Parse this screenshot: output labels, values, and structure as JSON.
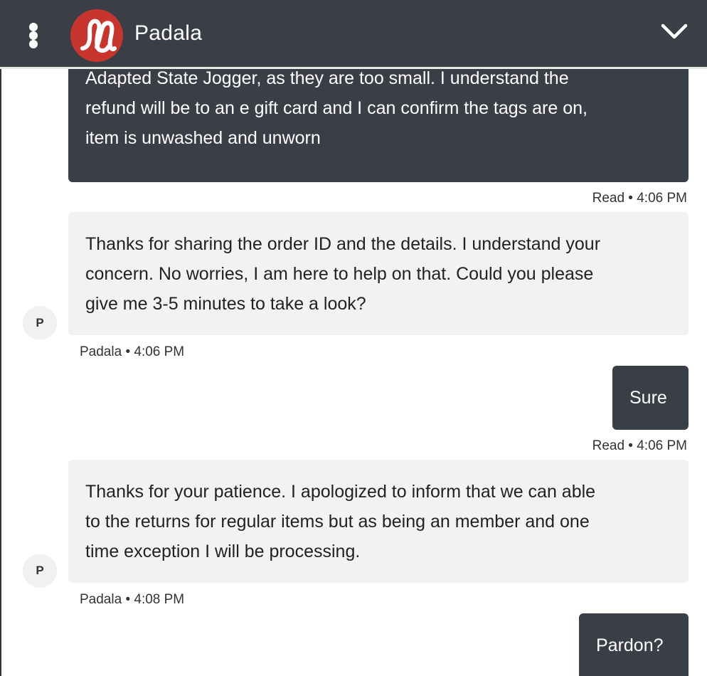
{
  "header": {
    "agent_name": "Padala",
    "menu_icon": "vertical-dots-icon",
    "logo": "lululemon-logo",
    "collapse_icon": "chevron-down-icon",
    "background": "#3a3f47",
    "logo_color": "#c8352f"
  },
  "messages": [
    {
      "sender": "user",
      "lines": [
        "Adapted State Jogger, as they are too small. I understand the",
        "refund will be to an e gift card and I can confirm the tags are on,",
        "item is unwashed and unworn"
      ],
      "meta": "Read • 4:06 PM"
    },
    {
      "sender": "agent",
      "avatar": "P",
      "lines": [
        "Thanks for sharing the order ID and the details. I understand your",
        "concern. No worries, I am here to help on that. Could you please",
        "give me 3-5 minutes to take a look?"
      ],
      "meta": "Padala • 4:06 PM"
    },
    {
      "sender": "user",
      "lines": [
        "Sure"
      ],
      "meta": "Read • 4:06 PM"
    },
    {
      "sender": "agent",
      "avatar": "P",
      "lines": [
        "Thanks for your patience. I apologized to inform that we can able",
        "to the returns for regular items but as being an member and one",
        "time exception I will be processing."
      ],
      "meta": "Padala • 4:08 PM"
    },
    {
      "sender": "user",
      "lines": [
        "Pardon?"
      ]
    }
  ]
}
